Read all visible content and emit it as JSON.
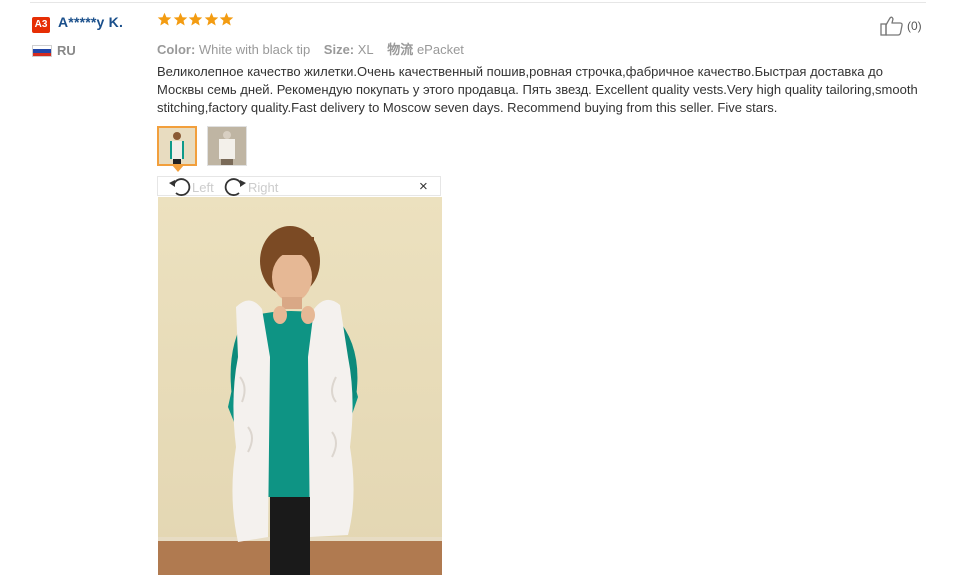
{
  "user": {
    "badge": "A3",
    "name": "A*****y K.",
    "country": "RU"
  },
  "rating": {
    "stars": 5,
    "max": 5,
    "color": "#f39c12"
  },
  "meta": {
    "color_label": "Color:",
    "color_value": "White with black tip",
    "size_label": "Size:",
    "size_value": "XL",
    "shipping_label": "物流",
    "shipping_value": "ePacket"
  },
  "helpful": {
    "count": "(0)"
  },
  "review": {
    "text": "Великолепное качество жилетки.Очень качественный пошив,ровная строчка,фабричное качество.Быстрая доставка до Москвы семь дней. Рекомендую покупать у этого продавца. Пять звезд. Excellent quality vests.Very high quality tailoring,smooth stitching,factory quality.Fast delivery to Moscow seven days. Recommend buying from this seller. Five stars."
  },
  "viewer": {
    "rotate_left": "Left",
    "rotate_right": "Right",
    "close": "×"
  },
  "colors": {
    "username": "#1a4f8b",
    "badge": "#e62e04",
    "thumb_active": "#f29f3c"
  }
}
